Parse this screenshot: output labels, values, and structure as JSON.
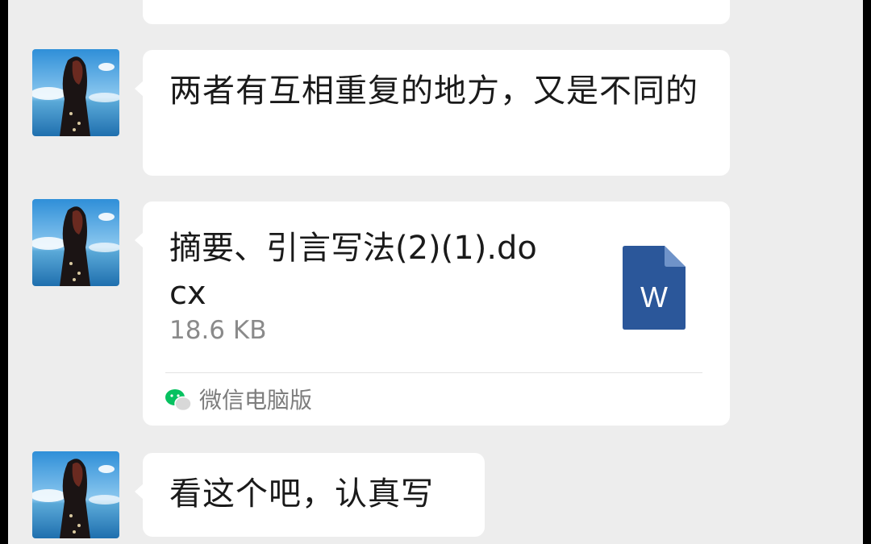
{
  "colors": {
    "background": "#ededed",
    "bubble": "#ffffff",
    "word_icon": "#2b579a",
    "wechat_green": "#07c160"
  },
  "messages": [
    {
      "type": "text",
      "text": "两者有互相重复的地方，又是不同的"
    },
    {
      "type": "file",
      "file_name": "摘要、引言写法(2)(1).docx",
      "file_size": "18.6 KB",
      "file_icon": "word-document-icon",
      "icon_letter": "W",
      "source_icon": "wechat-icon",
      "source_label": "微信电脑版"
    },
    {
      "type": "text",
      "text": "看这个吧，认真写"
    }
  ]
}
